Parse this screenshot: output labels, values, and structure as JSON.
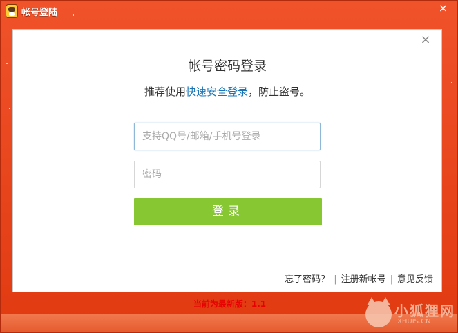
{
  "window": {
    "title": "帐号登陆",
    "close_glyph": "×"
  },
  "panel": {
    "close_glyph": "×",
    "heading": "帐号密码登录",
    "subtitle_before": "推荐使用",
    "subtitle_link": "快速安全登录",
    "subtitle_after": "，防止盗号。",
    "username": {
      "value": "",
      "placeholder": "支持QQ号/邮箱/手机号登录"
    },
    "password": {
      "value": "",
      "placeholder": "密码"
    },
    "login_label": "登录",
    "links": {
      "forgot": "忘了密码？",
      "register": "注册新帐号",
      "feedback": "意见反馈",
      "separator": "|"
    }
  },
  "status": {
    "version_text": "当前为最新版：1.1"
  },
  "watermark": {
    "cn": "小狐狸网",
    "en": "XHUIS.CN"
  },
  "colors": {
    "frame": "#e8431a",
    "login_button": "#86c732",
    "link": "#1874b6",
    "status_text": "#e60000"
  },
  "icons": {
    "app": "game-avatar-icon",
    "window_close": "close-icon",
    "panel_close": "close-icon"
  }
}
